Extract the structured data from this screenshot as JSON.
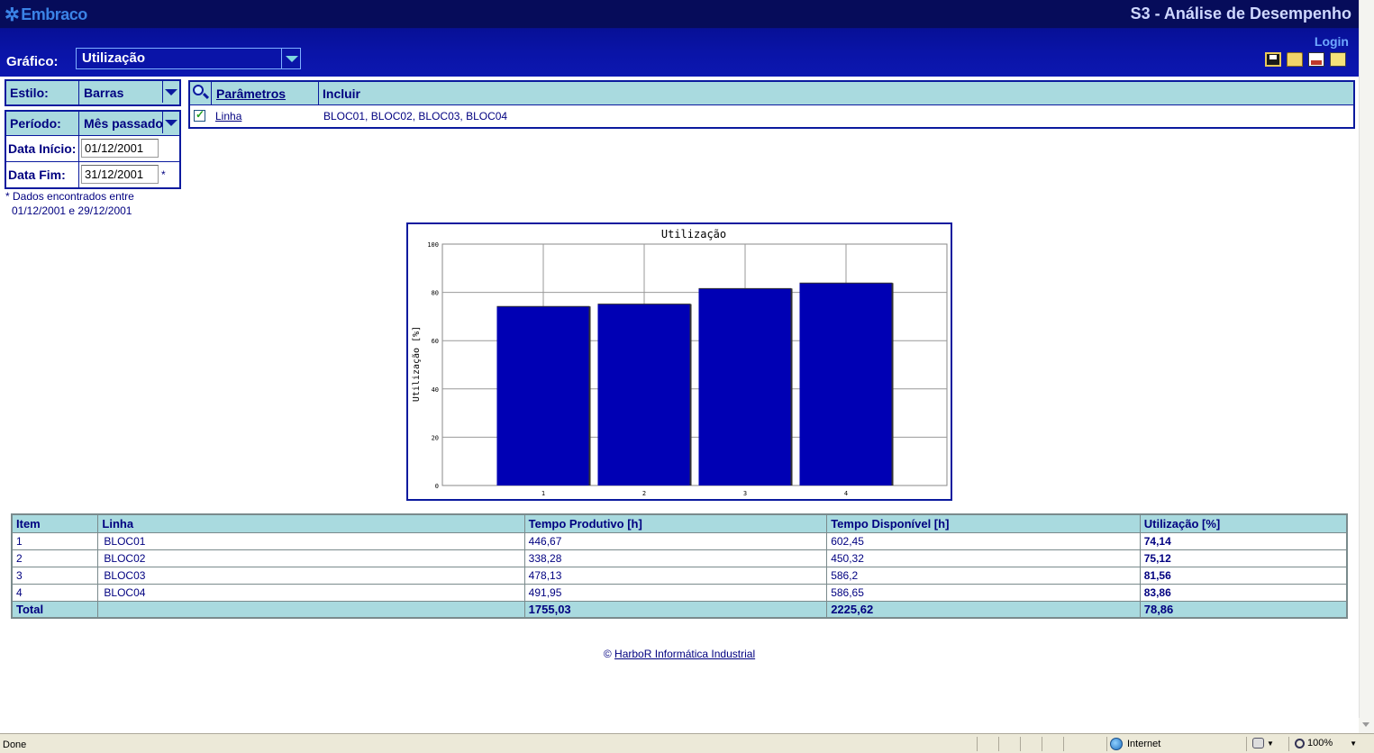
{
  "header": {
    "logo_text": "Embraco",
    "app_title": "S3 - Análise de Desempenho",
    "login_label": "Login",
    "grafico_label": "Gráfico:",
    "grafico_value": "Utilização",
    "toolbar_icons": [
      "save-icon",
      "open-folder-icon",
      "print-icon",
      "export-icon"
    ]
  },
  "filters": {
    "estilo_label": "Estilo:",
    "estilo_value": "Barras",
    "periodo_label": "Período:",
    "periodo_value": "Mês passado",
    "data_inicio_label": "Data Início:",
    "data_inicio_value": "01/12/2001",
    "data_fim_label": "Data Fim:",
    "data_fim_value": "31/12/2001",
    "data_fim_star": "*",
    "note_line1": "* Dados encontrados entre",
    "note_line2": "01/12/2001 e 29/12/2001"
  },
  "params": {
    "header_parametros": "Parâmetros",
    "header_incluir": "Incluir",
    "row_label": "Linha",
    "row_value": "BLOC01, BLOC02, BLOC03, BLOC04",
    "row_checked": true
  },
  "chart_data": {
    "type": "bar",
    "title": "Utilização",
    "xlabel": "",
    "ylabel": "Utilização [%]",
    "categories": [
      "1",
      "2",
      "3",
      "4"
    ],
    "values": [
      74.14,
      75.12,
      81.56,
      83.86
    ],
    "ylim": [
      0,
      100
    ],
    "yticks": [
      "0",
      "20",
      "40",
      "60",
      "80",
      "100"
    ],
    "grid": true,
    "bar_color": "#0000b4"
  },
  "table": {
    "headers": [
      "Item",
      "Linha",
      "Tempo Produtivo [h]",
      "Tempo Disponível [h]",
      "Utilização [%]"
    ],
    "rows": [
      [
        "1",
        "BLOC01",
        "446,67",
        "602,45",
        "74,14"
      ],
      [
        "2",
        "BLOC02",
        "338,28",
        "450,32",
        "75,12"
      ],
      [
        "3",
        "BLOC03",
        "478,13",
        "586,2",
        "81,56"
      ],
      [
        "4",
        "BLOC04",
        "491,95",
        "586,65",
        "83,86"
      ]
    ],
    "total": [
      "Total",
      "",
      "1755,03",
      "2225,62",
      "78,86"
    ]
  },
  "footer": {
    "copyright": "©",
    "link_text": "HarboR Informática Industrial"
  },
  "statusbar": {
    "status": "Done",
    "zone": "Internet",
    "zoom": "100%"
  }
}
